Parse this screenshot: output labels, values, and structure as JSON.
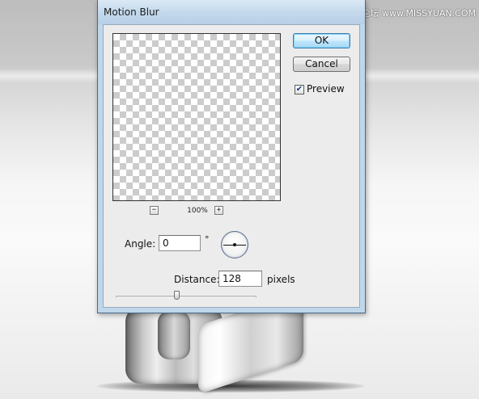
{
  "watermark": "思缘设计论坛 www.MISSYUAN.COM",
  "dialog": {
    "title": "Motion Blur",
    "buttons": {
      "ok": "OK",
      "cancel": "Cancel"
    },
    "preview_checkbox": {
      "label": "Preview",
      "checked": true,
      "mark": "✔"
    },
    "zoom": {
      "minus": "−",
      "plus": "+",
      "level": "100%"
    },
    "angle": {
      "label": "Angle:",
      "value": "0",
      "unit": "°"
    },
    "distance": {
      "label": "Distance:",
      "value": "128",
      "unit": "pixels"
    },
    "distance_slider": {
      "level_fraction": 0.43
    }
  },
  "colors": {
    "default_button_border": "#3c7fb1",
    "titlebar": "#c4d9ec"
  },
  "icons": {
    "angle_dial": "angle-dial-icon",
    "checkmark": "checkmark-icon"
  }
}
